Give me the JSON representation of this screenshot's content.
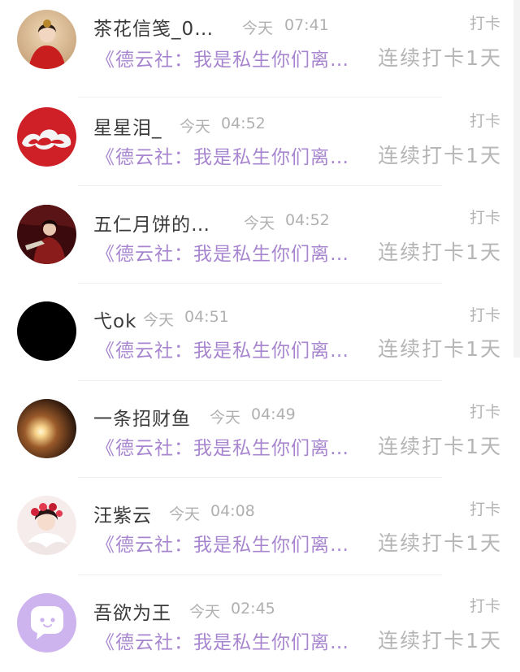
{
  "colors": {
    "name": "#3a3a3a",
    "time": "#b0b0b0",
    "message": "#a786cf",
    "streak": "#b5b5b5",
    "tag": "#b3b3b3"
  },
  "items": [
    {
      "name": "茶花信笺_0…",
      "day": "今天",
      "time": "07:41",
      "tag": "打卡",
      "message": "《德云社：我是私生你们离…",
      "streak": "连续打卡1天",
      "avatar_icon": "woman-in-red-hanfu-avatar"
    },
    {
      "name": "星星泪_",
      "day": "今天",
      "time": "04:52",
      "tag": "打卡",
      "message": "《德云社：我是私生你们离…",
      "streak": "连续打卡1天",
      "avatar_icon": "red-cloud-pattern-avatar"
    },
    {
      "name": "五仁月饼的…",
      "day": "今天",
      "time": "04:52",
      "tag": "打卡",
      "message": "《德云社：我是私生你们离…",
      "streak": "连续打卡1天",
      "avatar_icon": "dark-red-costume-avatar"
    },
    {
      "name": "弋ok",
      "day": "今天",
      "time": "04:51",
      "tag": "打卡",
      "message": "《德云社：我是私生你们离…",
      "streak": "连续打卡1天",
      "avatar_icon": "black-avatar"
    },
    {
      "name": "一条招财鱼",
      "day": "今天",
      "time": "04:49",
      "tag": "打卡",
      "message": "《德云社：我是私生你们离…",
      "streak": "连续打卡1天",
      "avatar_icon": "glowing-sun-avatar"
    },
    {
      "name": "汪紫云",
      "day": "今天",
      "time": "04:08",
      "tag": "打卡",
      "message": "《德云社：我是私生你们离…",
      "streak": "连续打卡1天",
      "avatar_icon": "girl-with-flowers-avatar"
    },
    {
      "name": "吾欲为王",
      "day": "今天",
      "time": "02:45",
      "tag": "打卡",
      "message": "《德云社：我是私生你们离…",
      "streak": "连续打卡1天",
      "avatar_icon": "default-chat-avatar"
    }
  ]
}
